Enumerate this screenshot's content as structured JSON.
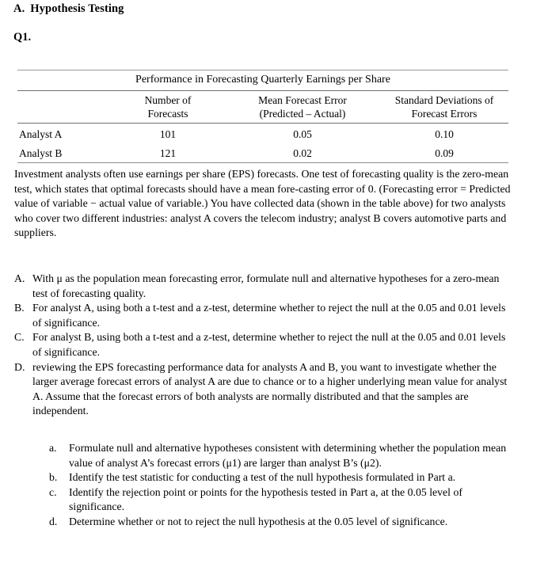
{
  "document": {
    "section_heading": {
      "letter": "A.",
      "text": "Hypothesis Testing"
    },
    "question_label": "Q1.",
    "table": {
      "title": "Performance in Forecasting Quarterly Earnings per Share",
      "columns": [
        {
          "line1": "",
          "line2": ""
        },
        {
          "line1": "Number of",
          "line2": "Forecasts"
        },
        {
          "line1": "Mean Forecast Error",
          "line2": "(Predicted – Actual)"
        },
        {
          "line1": "Standard Deviations of",
          "line2": "Forecast Errors"
        }
      ],
      "rows": [
        {
          "label": "Analyst A",
          "number_of_forecasts": "101",
          "mean_forecast_error": "0.05",
          "std_dev_forecast_errors": "0.10"
        },
        {
          "label": "Analyst B",
          "number_of_forecasts": "121",
          "mean_forecast_error": "0.02",
          "std_dev_forecast_errors": "0.09"
        }
      ]
    },
    "paragraph": "Investment analysts often use earnings per share (EPS) forecasts. One test of forecasting quality is the zero-mean test, which states that optimal forecasts should have a mean fore-casting error of 0. (Forecasting error = Predicted value of variable − actual value of variable.) You have collected data (shown in the table above) for two analysts who cover two different industries: analyst A covers the telecom industry; analyst B covers automotive parts and suppliers.",
    "questions_upper": [
      {
        "marker": "A.",
        "text": "With μ as the population mean forecasting error, formulate null and alternative hypotheses for a zero-mean test of forecasting quality."
      },
      {
        "marker": "B.",
        "text": "For analyst A, using both a t-test and a z-test, determine whether to reject the null at the 0.05 and 0.01 levels of significance."
      },
      {
        "marker": "C.",
        "text": "For analyst B, using both a t-test and a z-test, determine whether to reject the null at the 0.05 and 0.01 levels of significance."
      },
      {
        "marker": "D.",
        "text": "reviewing the EPS forecasting performance data for analysts A and B, you want to investigate whether the larger average forecast errors of analyst A are due to chance or to a higher underlying mean value for analyst A. Assume that the forecast errors of both analysts are normally distributed and that the samples are independent."
      }
    ],
    "questions_lower": [
      {
        "marker": "a.",
        "text": "Formulate null and alternative hypotheses consistent with determining whether the population mean value of analyst A’s forecast errors (μ1) are larger than analyst B’s (μ2)."
      },
      {
        "marker": "b.",
        "text": "Identify the test statistic for conducting a test of the null hypothesis formulated in Part a."
      },
      {
        "marker": "c.",
        "text": "Identify the rejection point or points for the hypothesis tested in Part a, at the 0.05 level of significance."
      },
      {
        "marker": "d.",
        "text": "Determine whether or not to reject the null hypothesis at the 0.05 level of significance."
      }
    ]
  }
}
